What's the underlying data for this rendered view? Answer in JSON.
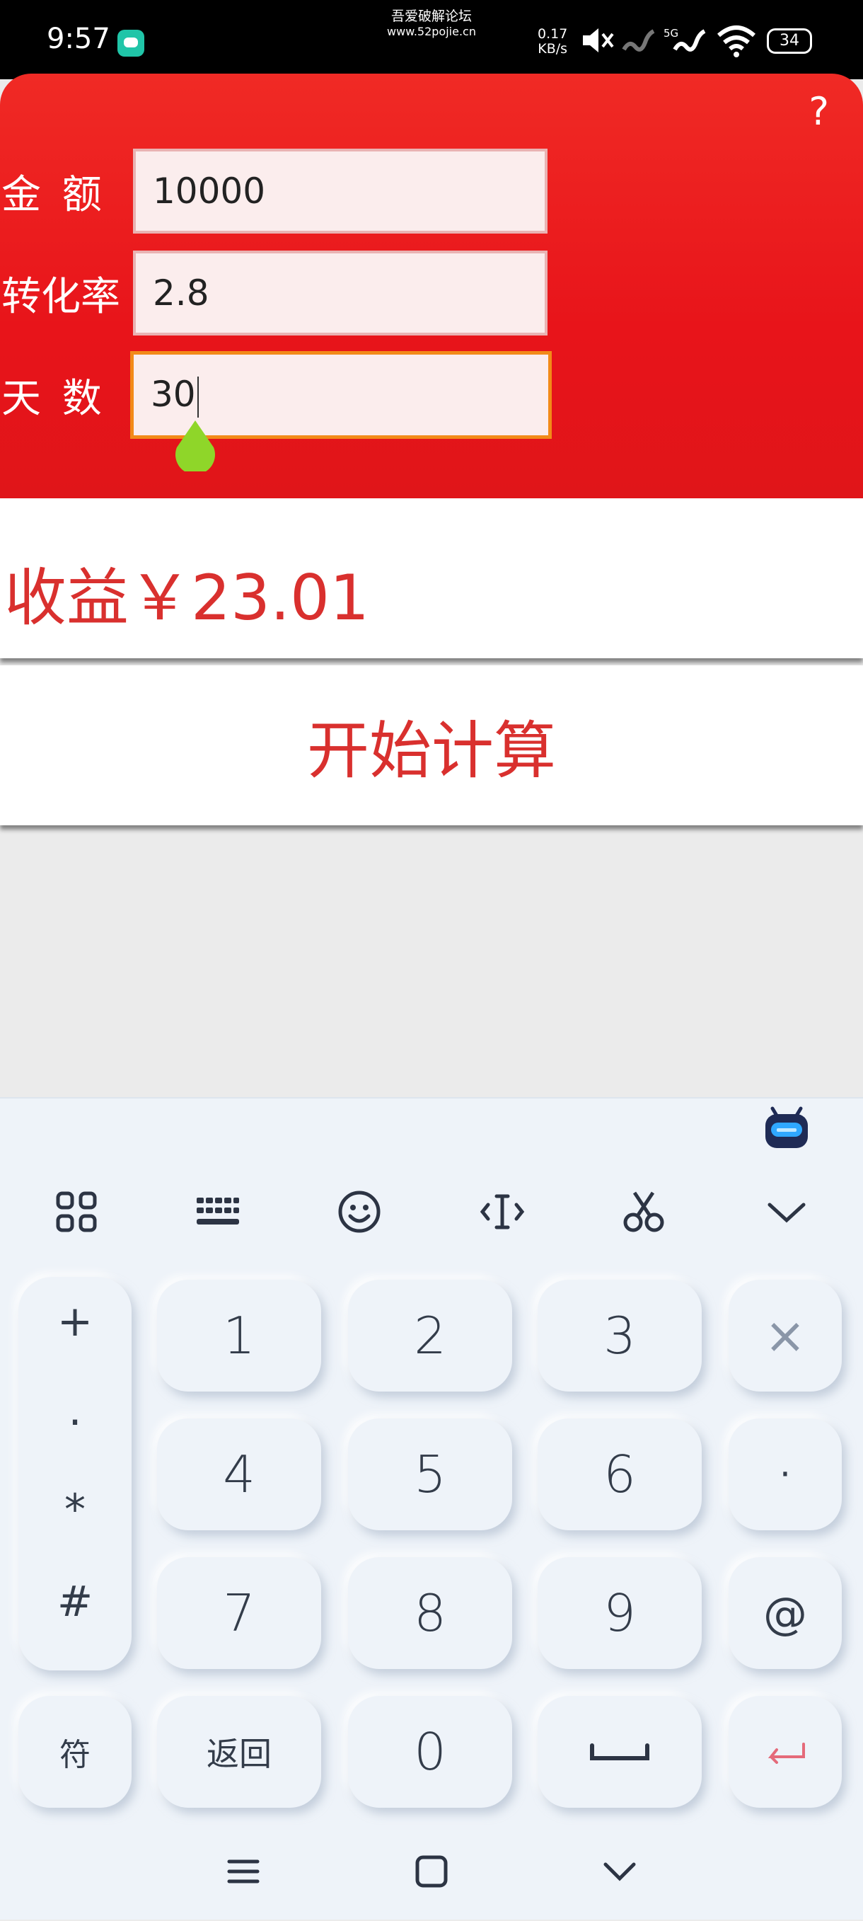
{
  "status_bar": {
    "time": "9:57",
    "watermark_line1": "吾爱破解论坛",
    "watermark_line2": "www.52pojie.cn",
    "net_speed_value": "0.17",
    "net_speed_unit": "KB/s",
    "network_label": "5G",
    "battery": "34"
  },
  "header": {
    "help": "?",
    "fields": [
      {
        "label": "金 额",
        "value": "10000"
      },
      {
        "label": "转化率",
        "value": "2.8"
      },
      {
        "label": "天 数",
        "value": "30"
      }
    ]
  },
  "result": {
    "text": "收益￥23.01"
  },
  "calculate_button": "开始计算",
  "keyboard": {
    "toolbar_icons": [
      "grid-icon",
      "keyboard-icon",
      "emoji-icon",
      "cursor-icon",
      "scissors-icon",
      "collapse-icon"
    ],
    "symbols": [
      "+",
      ".",
      "*",
      "#"
    ],
    "digits": [
      [
        "1",
        "2",
        "3"
      ],
      [
        "4",
        "5",
        "6"
      ],
      [
        "7",
        "8",
        "9"
      ]
    ],
    "special_row": {
      "symbols_key": "符",
      "back_key": "返回",
      "zero": "0"
    },
    "right_column": {
      "delete": "×",
      "dot": "·",
      "at": "@"
    },
    "colors": {
      "accent_red": "#d9302e",
      "enter_pink": "#e46a7a"
    }
  }
}
